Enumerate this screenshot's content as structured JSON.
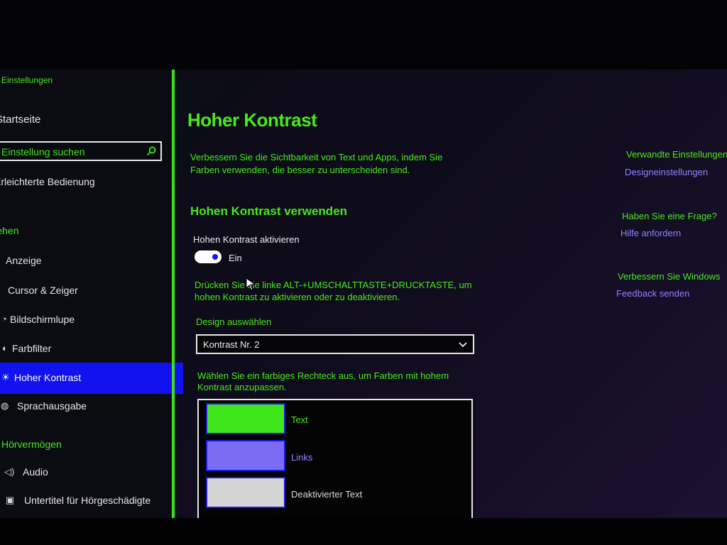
{
  "sidebar": {
    "app_title": "Einstellungen",
    "home": "Startseite",
    "search_placeholder": "Einstellung suchen",
    "ease_of_access": "Erleichterte Bedienung",
    "vision_heading": "Sehen",
    "items": [
      {
        "label": "Anzeige",
        "icon": "display-icon"
      },
      {
        "label": "Cursor & Zeiger",
        "icon": "cursor-icon"
      },
      {
        "label": "Bildschirmlupe",
        "icon": "magnifier-icon"
      },
      {
        "label": "Farbfilter",
        "icon": "color-filter-icon"
      },
      {
        "label": "Hoher Kontrast",
        "icon": "contrast-icon",
        "active": true
      },
      {
        "label": "Sprachausgabe",
        "icon": "narrator-icon"
      }
    ],
    "hearing_heading": "Hörvermögen",
    "hearing_items": [
      {
        "label": "Audio",
        "icon": "speaker-icon"
      },
      {
        "label": "Untertitel für Hörgeschädigte",
        "icon": "captions-icon"
      }
    ]
  },
  "main": {
    "title": "Hoher Kontrast",
    "description_line1": "Verbessern Sie die Sichtbarkeit von Text und Apps, indem Sie",
    "description_line2": "Farben verwenden, die besser zu unterscheiden sind.",
    "section_title": "Hohen Kontrast verwenden",
    "toggle_label": "Hohen Kontrast aktivieren",
    "toggle_state": "Ein",
    "shortcut_line1": "Drücken Sie die linke ALT-+UMSCHALTTASTE+DRUCKTASTE, um",
    "shortcut_line2": "hohen Kontrast zu aktivieren oder zu deaktivieren.",
    "design_label": "Design auswählen",
    "design_value": "Kontrast Nr. 2",
    "colors_hint_line1": "Wählen Sie ein farbiges Rechteck aus, um Farben mit hohem",
    "colors_hint_line2": "Kontrast anzupassen.",
    "swatches": [
      {
        "label": "Text",
        "color": "#3fe61b",
        "label_color": "#47ea1c"
      },
      {
        "label": "Links",
        "color": "#7b6cf4",
        "label_color": "#8f82ff"
      },
      {
        "label": "Deaktivierter Text",
        "color": "#d4d4d4",
        "label_color": "#d8d8d8"
      }
    ]
  },
  "right": {
    "related_heading": "Verwandte Einstellungen",
    "related_link": "Designeinstellungen",
    "question_heading": "Haben Sie eine Frage?",
    "question_link": "Hilfe anfordern",
    "improve_heading": "Verbessern Sie Windows",
    "improve_link": "Feedback senden"
  },
  "colors": {
    "accent_green": "#47ea1c",
    "link_purple": "#8f82ff",
    "selection_blue": "#1212f0"
  }
}
